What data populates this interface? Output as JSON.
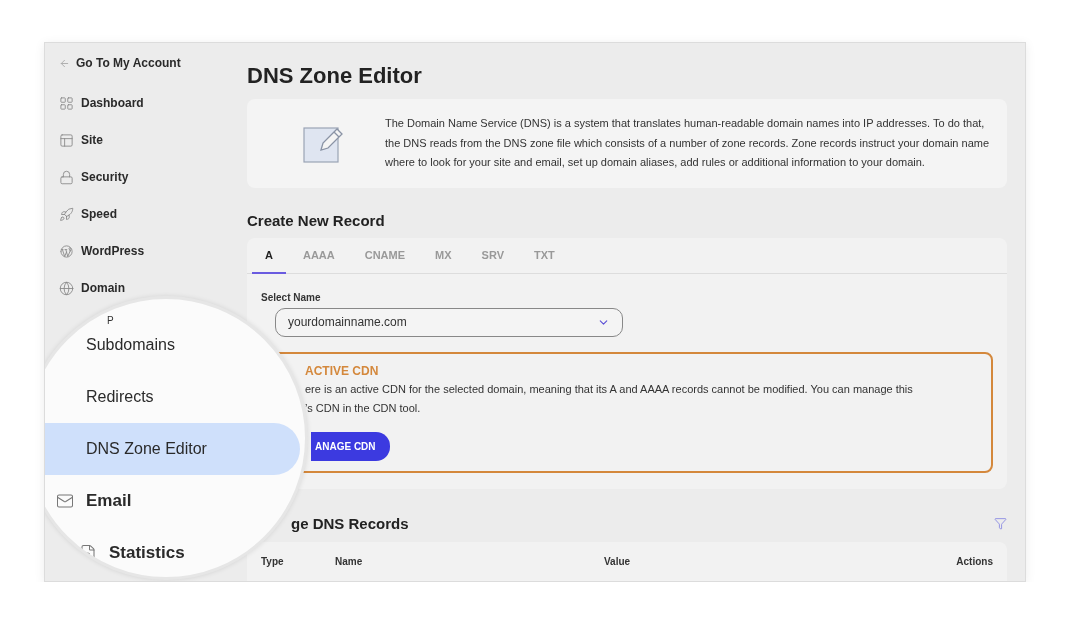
{
  "sidebar": {
    "back_link": "Go To My Account",
    "items": [
      {
        "label": "Dashboard",
        "kind": "dashboard"
      },
      {
        "label": "Site",
        "kind": "site"
      },
      {
        "label": "Security",
        "kind": "security"
      },
      {
        "label": "Speed",
        "kind": "speed"
      },
      {
        "label": "WordPress",
        "kind": "wordpress"
      },
      {
        "label": "Domain",
        "kind": "domain"
      }
    ]
  },
  "magnifier": {
    "partial_label": "P",
    "items": [
      {
        "label": "Subdomains",
        "kind": "subpage",
        "selected": false
      },
      {
        "label": "Redirects",
        "kind": "subpage",
        "selected": false
      },
      {
        "label": "DNS Zone Editor",
        "kind": "subpage",
        "selected": true
      },
      {
        "label": "Email",
        "kind": "email",
        "selected": false
      },
      {
        "label": "Statistics",
        "kind": "statistics",
        "selected": false
      }
    ]
  },
  "page": {
    "title": "DNS Zone Editor",
    "info": "The Domain Name Service (DNS) is a system that translates human-readable domain names into IP addresses. To do that, the DNS reads from the DNS zone file which consists of a number of zone records. Zone records instruct your domain name where to look for your site and email, set up domain aliases, add rules or additional information to your domain."
  },
  "create_record": {
    "heading": "Create New Record",
    "tabs": [
      {
        "label": "A",
        "selected": true
      },
      {
        "label": "AAAA",
        "selected": false
      },
      {
        "label": "CNAME",
        "selected": false
      },
      {
        "label": "MX",
        "selected": false
      },
      {
        "label": "SRV",
        "selected": false
      },
      {
        "label": "TXT",
        "selected": false
      }
    ],
    "select": {
      "label": "Select Name",
      "value": "yourdomainname.com"
    },
    "cdn_notice": {
      "title": "ACTIVE CDN",
      "text_lines": [
        "ere is an active CDN for the selected domain, meaning that its A and AAAA records cannot be modified. You can manage this",
        "’s CDN in the CDN tool."
      ],
      "button": "ANAGE CDN"
    }
  },
  "records": {
    "heading": "ge DNS Records",
    "columns": [
      "Type",
      "Name",
      "Value",
      "Actions"
    ]
  }
}
